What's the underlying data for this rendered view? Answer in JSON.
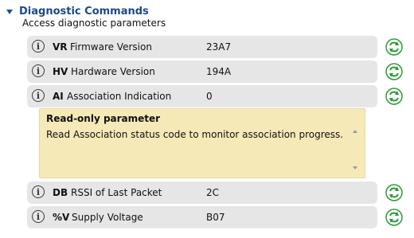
{
  "section": {
    "title": "Diagnostic Commands",
    "description": "Access diagnostic parameters"
  },
  "params": [
    {
      "code": "VR",
      "name": "Firmware Version",
      "value": "23A7"
    },
    {
      "code": "HV",
      "name": "Hardware Version",
      "value": "194A"
    },
    {
      "code": "AI",
      "name": "Association Indication",
      "value": "0"
    },
    {
      "code": "DB",
      "name": "RSSI of Last Packet",
      "value": "2C"
    },
    {
      "code": "%V",
      "name": "Supply Voltage",
      "value": "B07"
    }
  ],
  "help": {
    "title": "Read-only parameter",
    "text": "Read Association status code to monitor association progress."
  },
  "icons": {
    "info": "i",
    "refresh_color": "#2e9a3a"
  }
}
